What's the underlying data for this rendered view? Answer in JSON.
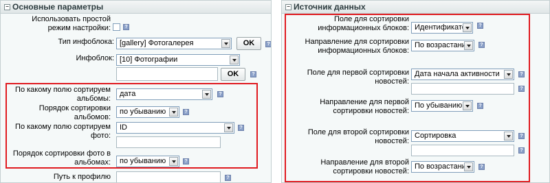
{
  "left_panel": {
    "title": "Основные параметры",
    "simple_mode_label": "Использовать простой режим настройки:",
    "iblock_type_label": "Тип инфоблока:",
    "iblock_type_value": "[gallery] Фотогалерея",
    "ok_label": "OK",
    "iblock_label": "Инфоблок:",
    "iblock_value": "[10] Фотографии",
    "album_sort_field_label": "По какому полю сортируем альбомы:",
    "album_sort_field_value": "дата",
    "album_sort_order_label": "Порядок сортировки альбомов:",
    "album_sort_order_value": "по убыванию",
    "photo_sort_field_label": "По какому полю сортируем фото:",
    "photo_sort_field_value": "ID",
    "photo_sort_order_label": "Порядок сортировки фото в альбомах:",
    "photo_sort_order_value": "по убыванию",
    "profile_path_label": "Путь к профилю пользователя:"
  },
  "right_panel": {
    "title": "Источник данных",
    "iblock_sort_field_label": "Поле для сортировки информационных блоков:",
    "iblock_sort_field_value": "Идентификатор",
    "iblock_sort_dir_label": "Направление для сортировки информационных блоков:",
    "iblock_sort_dir_value": "По возрастанию",
    "news_sort1_label": "Поле для первой сортировки новостей:",
    "news_sort1_value": "Дата начала активности",
    "news_dir1_label": "Направление для первой сортировки новостей:",
    "news_dir1_value": "По убыванию",
    "news_sort2_label": "Поле для второй сортировки новостей:",
    "news_sort2_value": "Сортировка",
    "news_dir2_label": "Направление для второй сортировки новостей:",
    "news_dir2_value": "По возрастанию"
  },
  "icons": {
    "collapse": "minus-icon",
    "help": "help-icon"
  },
  "colors": {
    "highlight_border": "#e0191f",
    "panel_bg": "#f5f9f9",
    "help_icon": "#8aa0c8"
  }
}
